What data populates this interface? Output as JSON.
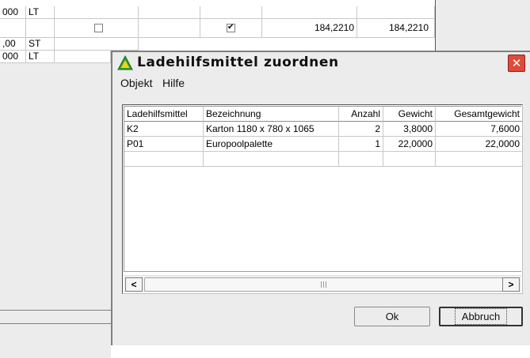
{
  "background": {
    "rows": [
      {
        "col0": "000",
        "col1": "LT"
      },
      {
        "col0": "",
        "col1": "",
        "checkbox1": false,
        "checkbox2": true,
        "value1": "184,2210",
        "value2": "184,2210"
      },
      {
        "col0": ",00",
        "col1": "ST"
      },
      {
        "col0": "000",
        "col1": "LT"
      }
    ]
  },
  "dialog": {
    "title": "Ladehilfsmittel zuordnen",
    "menu": [
      "Objekt",
      "Hilfe"
    ],
    "columns": [
      "Ladehilfsmittel",
      "Bezeichnung",
      "Anzahl",
      "Gewicht",
      "Gesamtgewicht"
    ],
    "rows": [
      [
        "K2",
        "Karton 1180 x 780 x 1065",
        "2",
        "3,8000",
        "7,6000"
      ],
      [
        "P01",
        "Europoolpalette",
        "1",
        "22,0000",
        "22,0000"
      ],
      [
        "",
        "",
        "",
        "",
        ""
      ]
    ],
    "scroll_left": "<",
    "scroll_right": ">",
    "ok_label": "Ok",
    "cancel_label": "Abbruch"
  },
  "colors": {
    "close_button": "#e04a3a",
    "window_bg": "#ececec",
    "icon_green": "#2e9e2e",
    "icon_yellow": "#f2d21a"
  }
}
